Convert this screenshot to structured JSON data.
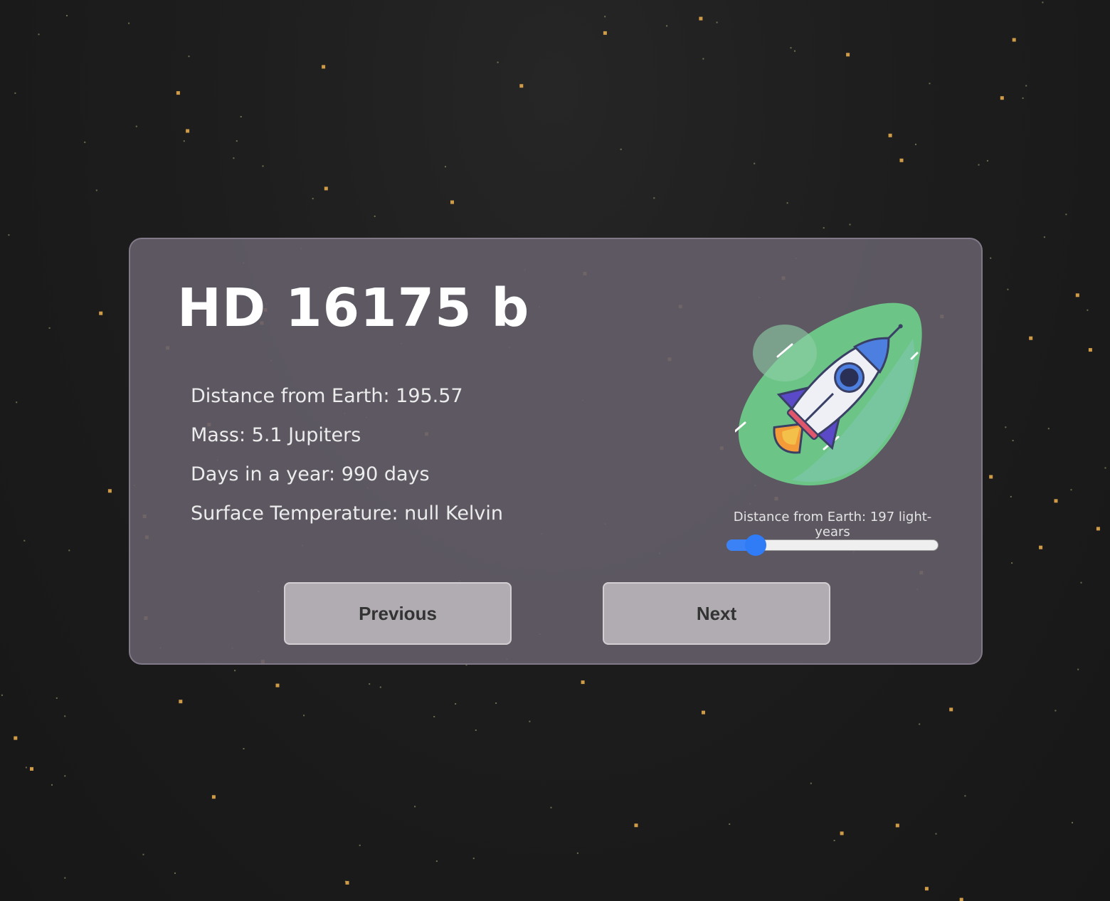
{
  "planet": {
    "name": "HD 16175 b",
    "facts": [
      "Distance from Earth: 195.57",
      "Mass: 5.1 Jupiters",
      "Days in a year: 990 days",
      "Surface Temperature: null Kelvin"
    ]
  },
  "distance_slider": {
    "label": "Distance from Earth: 197 light-years",
    "value_fraction": 0.14
  },
  "buttons": {
    "previous": "Previous",
    "next": "Next"
  },
  "illustration": {
    "icon": "rocket-icon"
  },
  "colors": {
    "background": "#1c1c1c",
    "card": "#5e5864",
    "star": "#d9a24a",
    "accent": "#3b82f6",
    "blob": "#6cc487",
    "button": "#b1acb1"
  }
}
